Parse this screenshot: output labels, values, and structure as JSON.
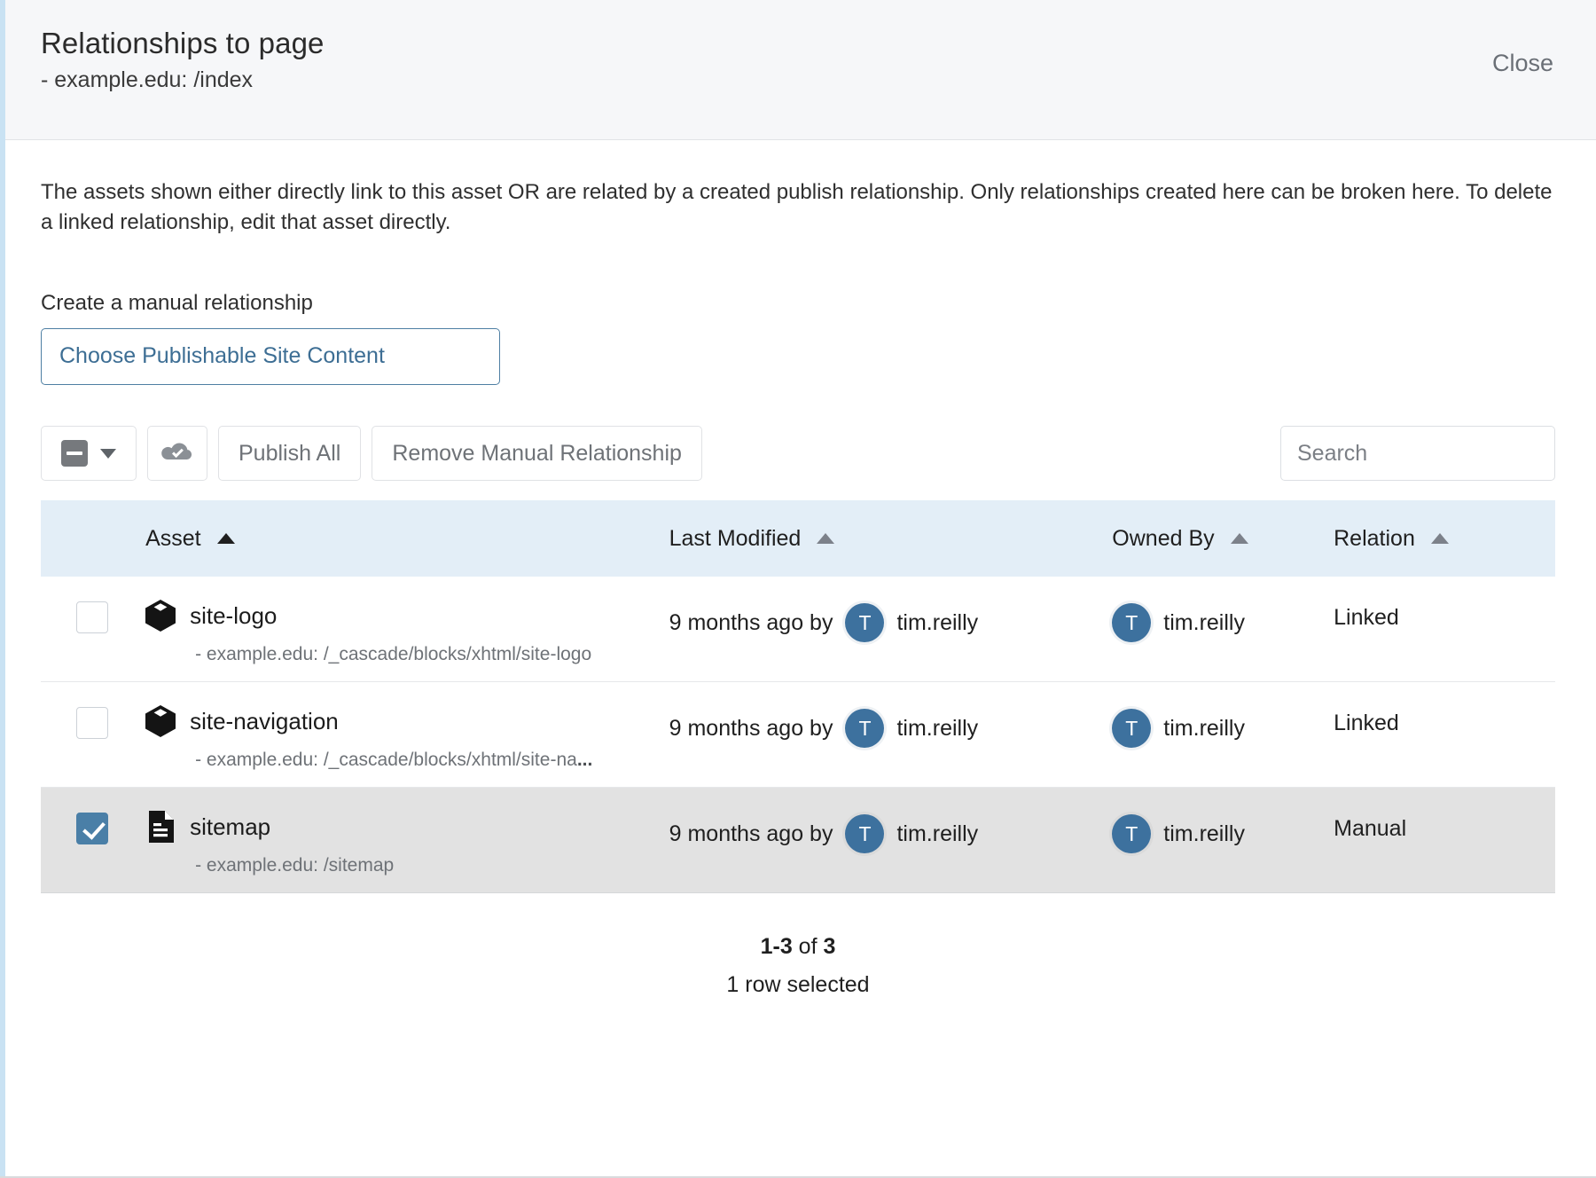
{
  "header": {
    "title": "Relationships to page",
    "subtitle": "- example.edu: /index",
    "close_label": "Close"
  },
  "body": {
    "description": "The assets shown either directly link to this asset OR are related by a created publish relationship. Only relationships created here can be broken here. To delete a linked relationship, edit that asset directly.",
    "create_label": "Create a manual relationship",
    "choose_button": "Choose Publishable Site Content"
  },
  "toolbar": {
    "select_icon": "indeterminate-checkbox",
    "chevron_icon": "chevron-down-icon",
    "publish_icon": "cloud-check-icon",
    "publish_all_label": "Publish All",
    "remove_relationship_label": "Remove Manual Relationship",
    "search_placeholder": "Search",
    "search_value": ""
  },
  "table": {
    "columns": [
      {
        "label": "Asset",
        "sort_icon": "sort-ascending-icon",
        "sort_active": true
      },
      {
        "label": "Last Modified",
        "sort_icon": "sort-ascending-icon",
        "sort_active": false
      },
      {
        "label": "Owned By",
        "sort_icon": "sort-ascending-icon",
        "sort_active": false
      },
      {
        "label": "Relation",
        "sort_icon": "sort-ascending-icon",
        "sort_active": false
      }
    ],
    "rows": [
      {
        "checked": false,
        "selected": false,
        "icon": "block-icon",
        "name": "site-logo",
        "path": "- example.edu: /_cascade/blocks/xhtml/site-logo",
        "truncated": "",
        "modified": "9 months ago by",
        "modified_by": "tim.reilly",
        "modified_by_initial": "T",
        "owner": "tim.reilly",
        "owner_initial": "T",
        "relation": "Linked"
      },
      {
        "checked": false,
        "selected": false,
        "icon": "block-icon",
        "name": "site-navigation",
        "path": "- example.edu: /_cascade/blocks/xhtml/site-na",
        "truncated": "...",
        "modified": "9 months ago by",
        "modified_by": "tim.reilly",
        "modified_by_initial": "T",
        "owner": "tim.reilly",
        "owner_initial": "T",
        "relation": "Linked"
      },
      {
        "checked": true,
        "selected": true,
        "icon": "page-icon",
        "name": "sitemap",
        "path": "- example.edu: /sitemap",
        "truncated": "",
        "modified": "9 months ago by",
        "modified_by": "tim.reilly",
        "modified_by_initial": "T",
        "owner": "tim.reilly",
        "owner_initial": "T",
        "relation": "Manual"
      }
    ]
  },
  "footer": {
    "range": "1-3",
    "of_word": " of ",
    "total": "3",
    "rows_selected": "1 row selected"
  },
  "colors": {
    "accent": "#3d719e",
    "header_bg": "#e3eef7",
    "link": "#3d6e94",
    "selected_row": "#e2e2e2",
    "selected_bar": "#c9e2f3"
  }
}
